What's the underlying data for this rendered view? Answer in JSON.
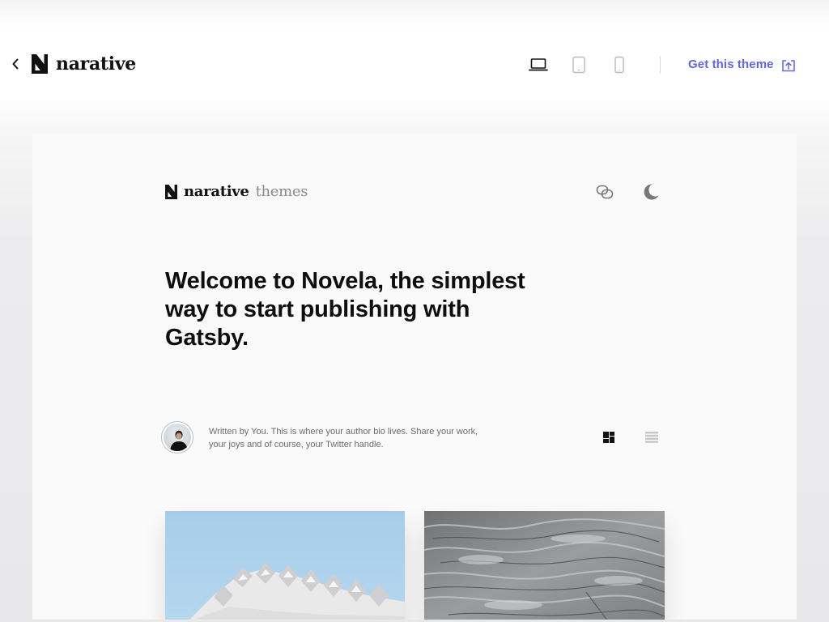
{
  "topbar": {
    "back_label": "Back",
    "brand_name": "narative",
    "devices": [
      {
        "name": "laptop-icon",
        "active": true
      },
      {
        "name": "tablet-icon",
        "active": false
      },
      {
        "name": "phone-icon",
        "active": false
      }
    ],
    "cta_label": "Get this theme",
    "cta_color": "#6166dc"
  },
  "preview": {
    "logo_name": "narative",
    "logo_sub": "themes",
    "hero_title": "Welcome to Novela, the simplest way to start publishing with Gatsby.",
    "author_bio": "Written by You. This is where your author bio lives. Share your work, your joys and of course, your Twitter handle.",
    "view_modes": [
      {
        "name": "grid-view-icon",
        "active": true
      },
      {
        "name": "list-view-icon",
        "active": false
      }
    ],
    "articles": [
      {
        "image": "white-building-facade",
        "sky_color": "#a9cfe9"
      },
      {
        "image": "grey-rock-texture",
        "base_color": "#8d8f91"
      }
    ]
  }
}
